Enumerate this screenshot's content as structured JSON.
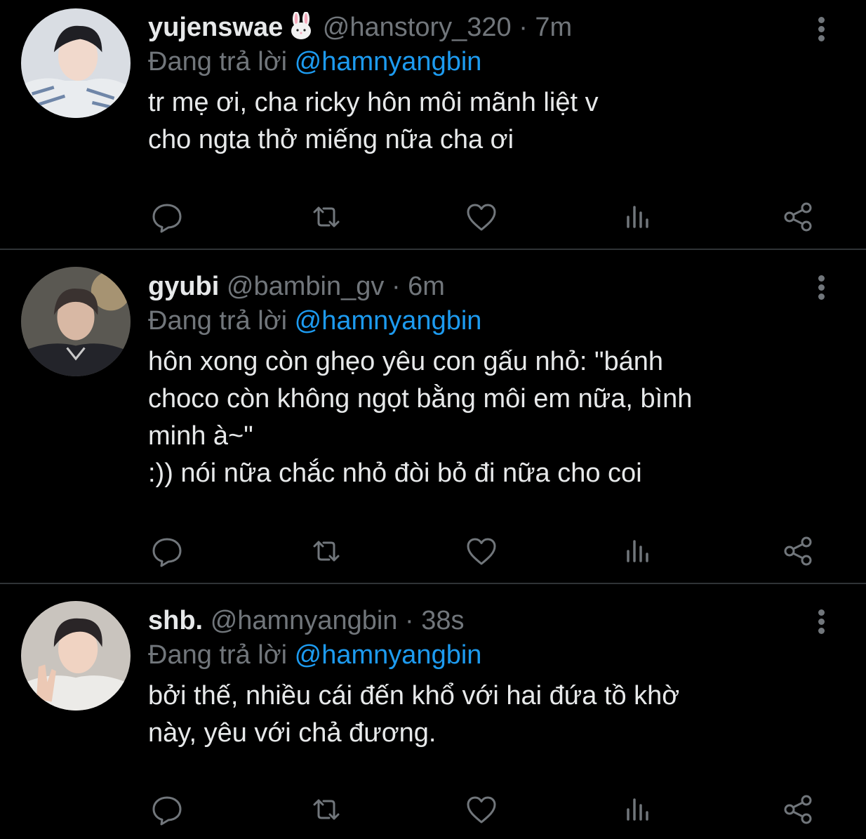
{
  "theme": {
    "background": "#000000",
    "text": "#e7e9ea",
    "muted": "#71767b",
    "link": "#1d9bf0",
    "divider": "#2f3336"
  },
  "tweets": [
    {
      "name": "yujenswae",
      "name_emoji": "rabbit-face-emoji",
      "handle": "@hanstory_320",
      "dot": "·",
      "time": "7m",
      "replying_prefix": "Đang trả lời",
      "replying_to": "@hamnyangbin",
      "text": "tr mẹ ơi, cha ricky hôn môi mãnh liệt v\ncho ngta thở miếng nữa cha ơi"
    },
    {
      "name": "gyubi",
      "handle": "@bambin_gv",
      "dot": "·",
      "time": "6m",
      "replying_prefix": "Đang trả lời",
      "replying_to": "@hamnyangbin",
      "text": "hôn xong còn ghẹo yêu con gấu nhỏ: \"bánh\nchoco còn không ngọt bằng môi em nữa, bình\nminh à~\"\n:)) nói nữa chắc nhỏ đòi bỏ đi nữa cho coi"
    },
    {
      "name": "shb.",
      "handle": "@hamnyangbin",
      "dot": "·",
      "time": "38s",
      "replying_prefix": "Đang trả lời",
      "replying_to": "@hamnyangbin",
      "text": "bởi thế, nhiều cái đến khổ với hai đứa tồ khờ\nnày, yêu với chả đương."
    }
  ],
  "action_icons": [
    "reply-icon",
    "retweet-icon",
    "like-icon",
    "analytics-icon",
    "share-icon"
  ],
  "overflow_icon": "more-vertical-icon"
}
